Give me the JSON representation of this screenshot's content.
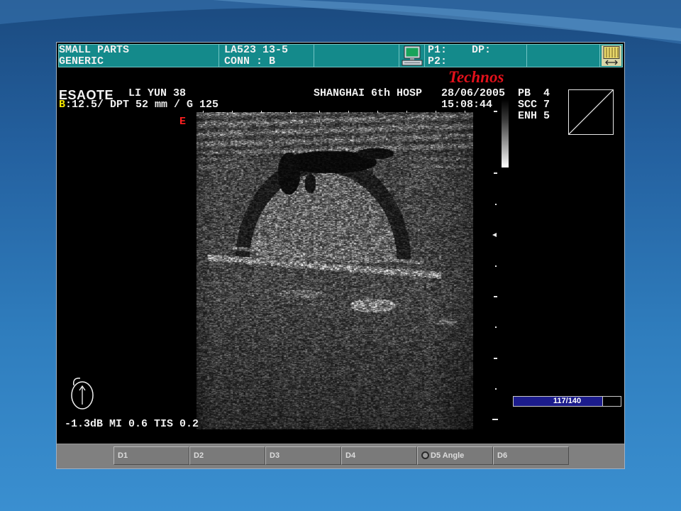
{
  "header": {
    "preset_line1": "SMALL PARTS",
    "preset_line2": "GENERIC",
    "probe_line1": "LA523 13-5",
    "probe_line2": "CONN : B",
    "p1_label": "P1:",
    "p2_label": "P2:",
    "dp_label": "DP:"
  },
  "brand": {
    "product": "Technos",
    "manufacturer": "ESAOTE"
  },
  "patient": {
    "name": "LI YUN 38",
    "hospital": "SHANGHAI 6th HOSP",
    "date": "28/06/2005",
    "time": "15:08:44"
  },
  "imaging": {
    "mode_letter": "B",
    "mode_params": ":12.5/ DPT 52 mm / G 125",
    "orientation_marker": "E",
    "settings": [
      "PB  4",
      "SCC 7",
      "ENH 5"
    ],
    "output_power": "-1.3dB MI 0.6 TIS 0.2"
  },
  "cine": {
    "label": "117/140",
    "frame": 117,
    "total": 140
  },
  "softkeys": [
    {
      "label": "D1"
    },
    {
      "label": "D2"
    },
    {
      "label": "D3"
    },
    {
      "label": "D4"
    },
    {
      "label": "D5 Angle",
      "icon": "circle-icon"
    },
    {
      "label": "D6"
    }
  ],
  "icons": {
    "header_status": "monitor-icon",
    "header_archive": "archive-folder-icon",
    "probe_orientation": "probe-orientation-icon",
    "focus": "focus-marker-icon",
    "reference": "reference-thumbnail-icon"
  },
  "colors": {
    "header_bg": "#148a8b",
    "brand_red": "#e3111b",
    "mode_letter": "#f2e400",
    "cine_fill": "#1c1c8c",
    "softkey_bg": "#7a7a7a",
    "screen_bg": "#000000",
    "slide_bg": "#2f7dbd"
  }
}
